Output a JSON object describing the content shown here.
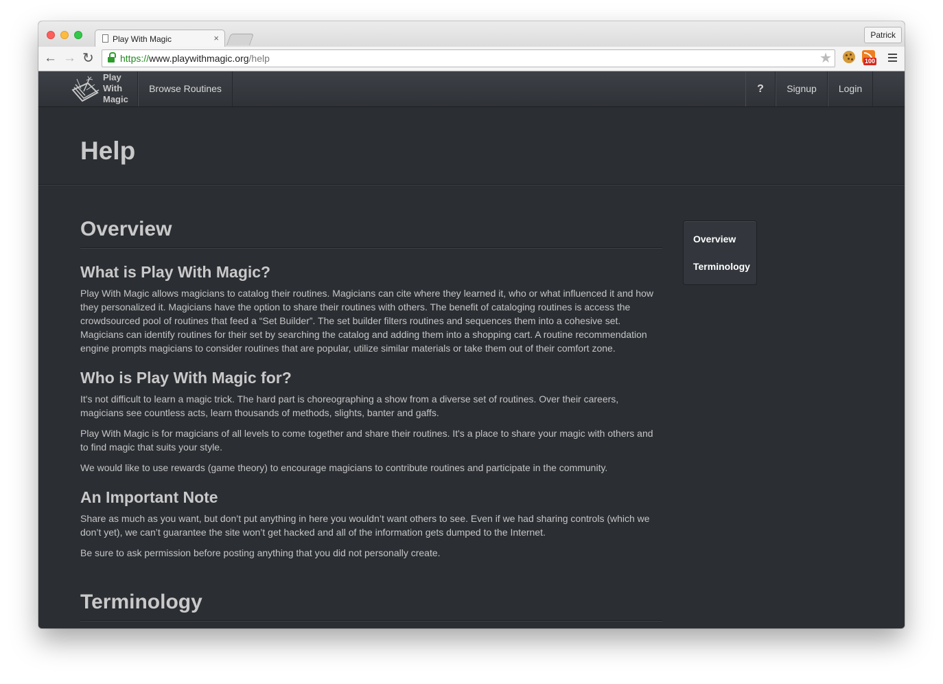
{
  "browser": {
    "tab_title": "Play With Magic",
    "tab_close": "×",
    "profile_name": "Patrick",
    "url_scheme": "https://",
    "url_host": "www.playwithmagic.org",
    "url_path": "/help",
    "rss_badge": "100",
    "icons": [
      "back-arrow-icon",
      "forward-arrow-icon",
      "reload-icon",
      "lock-icon",
      "star-icon",
      "cookie-icon",
      "rss-icon",
      "menu-icon"
    ]
  },
  "site_nav": {
    "brand": [
      "Play",
      "With",
      "Magic"
    ],
    "browse": "Browse Routines",
    "help": "?",
    "signup": "Signup",
    "login": "Login"
  },
  "page": {
    "title": "Help",
    "sidebar": [
      "Overview",
      "Terminology"
    ],
    "overview": {
      "heading": "Overview",
      "what_heading": "What is Play With Magic?",
      "what_p1": "Play With Magic allows magicians to catalog their routines. Magicians can cite where they learned it, who or what influenced it and how they personalized it. Magicians have the option to share their routines with others. The benefit of cataloging routines is access the crowdsourced pool of routines that feed a “Set Builder”. The set builder filters routines and sequences them into a cohesive set. Magicians can identify routines for their set by searching the catalog and adding them into a shopping cart. A routine recommendation engine prompts magicians to consider routines that are popular, utilize similar materials or take them out of their comfort zone.",
      "who_heading": "Who is Play With Magic for?",
      "who_p1": "It's not difficult to learn a magic trick. The hard part is choreographing a show from a diverse set of routines. Over their careers, magicians see countless acts, learn thousands of methods, slights, banter and gaffs.",
      "who_p2": "Play With Magic is for magicians of all levels to come together and share their routines. It's a place to share your magic with others and to find magic that suits your style.",
      "who_p3": "We would like to use rewards (game theory) to encourage magicians to contribute routines and participate in the community.",
      "note_heading": "An Important Note",
      "note_p1": "Share as much as you want, but don’t put anything in here you wouldn’t want others to see. Even if we had sharing controls (which we don’t yet), we can’t guarantee the site won’t get hacked and all of the information gets dumped to the Internet.",
      "note_p2": "Be sure to ask permission before posting anything that you did not personally create."
    },
    "terminology": {
      "heading": "Terminology"
    }
  },
  "colors": {
    "page_bg": "#2b2e33",
    "navbar_bg": "#33373c",
    "text": "#c9c9c9",
    "link": "#ffffff",
    "secure_green": "#1f8a1f"
  }
}
